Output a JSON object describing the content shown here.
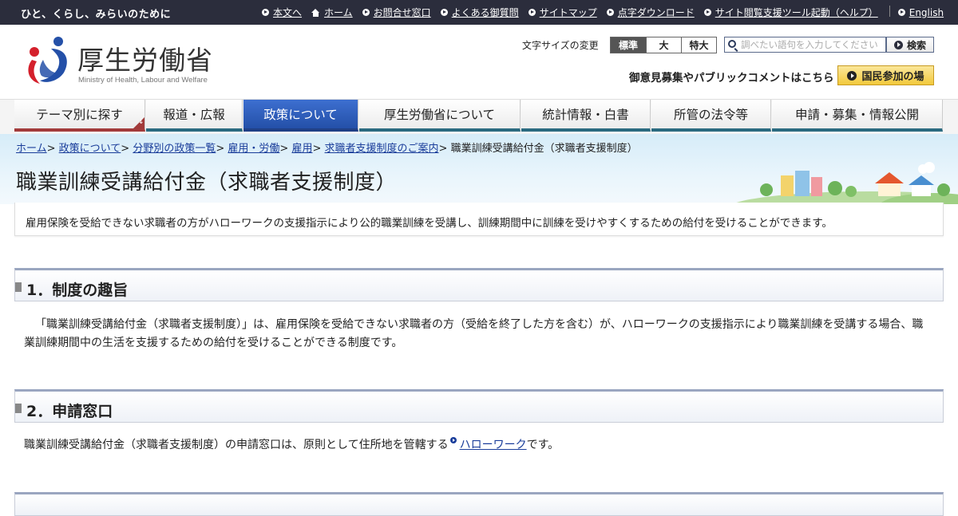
{
  "topbar": {
    "tagline": "ひと、くらし、みらいのために",
    "links": [
      {
        "label": "本文へ",
        "icon": "arrow-circle-icon"
      },
      {
        "label": "ホーム",
        "icon": "home-icon"
      },
      {
        "label": "お問合せ窓口",
        "icon": "arrow-circle-icon"
      },
      {
        "label": "よくある御質問",
        "icon": "arrow-circle-icon"
      },
      {
        "label": "サイトマップ",
        "icon": "arrow-circle-icon"
      },
      {
        "label": "点字ダウンロード",
        "icon": "arrow-circle-icon"
      },
      {
        "label": "サイト閲覧支援ツール起動（ヘルプ）",
        "icon": "arrow-circle-icon"
      },
      {
        "label": "English",
        "icon": "arrow-circle-icon"
      }
    ]
  },
  "header": {
    "logo_name": "厚生労働省",
    "logo_sub": "Ministry of Health, Labour and Welfare",
    "fontsize_label": "文字サイズの変更",
    "fontsize_options": [
      "標準",
      "大",
      "特大"
    ],
    "search_placeholder": "調べたい語句を入力してください",
    "search_button": "検索",
    "public_comment": "御意見募集やパブリックコメントはこちら",
    "participation_button": "国民参加の場"
  },
  "gnav": {
    "items": [
      {
        "label": "テーマ別に探す"
      },
      {
        "label": "報道・広報"
      },
      {
        "label": "政策について"
      },
      {
        "label": "厚生労働省について"
      },
      {
        "label": "統計情報・白書"
      },
      {
        "label": "所管の法令等"
      },
      {
        "label": "申請・募集・情報公開"
      }
    ]
  },
  "breadcrumb": {
    "links": [
      "ホーム",
      "政策について",
      "分野別の政策一覧",
      "雇用・労働",
      "雇用",
      "求職者支援制度のご案内"
    ],
    "current": "職業訓練受講給付金（求職者支援制度）",
    "separator": ">"
  },
  "page": {
    "title": "職業訓練受講給付金（求職者支援制度）",
    "lead": "雇用保険を受給できない求職者の方がハローワークの支援指示により公的職業訓練を受講し、訓練期間中に訓練を受けやすくするための給付を受けることができます。"
  },
  "sections": [
    {
      "title": "1．制度の趣旨",
      "body": "「職業訓練受講給付金（求職者支援制度）」は、雇用保険を受給できない求職者の方（受給を終了した方を含む）が、ハローワークの支援指示により職業訓練を受講する場合、職業訓練期間中の生活を支援するための給付を受けることができる制度です。"
    },
    {
      "title": "2．申請窓口",
      "body_before": "職業訓練受講給付金（求職者支援制度）の申請窓口は、原則として住所地を管轄する",
      "link": "ハローワーク",
      "body_after": "です。"
    }
  ],
  "colors": {
    "topbar_bg": "#2b2d3c",
    "nav_active": "#2450a8",
    "link": "#1a3d9a",
    "participation_button": "#f2c93c"
  }
}
